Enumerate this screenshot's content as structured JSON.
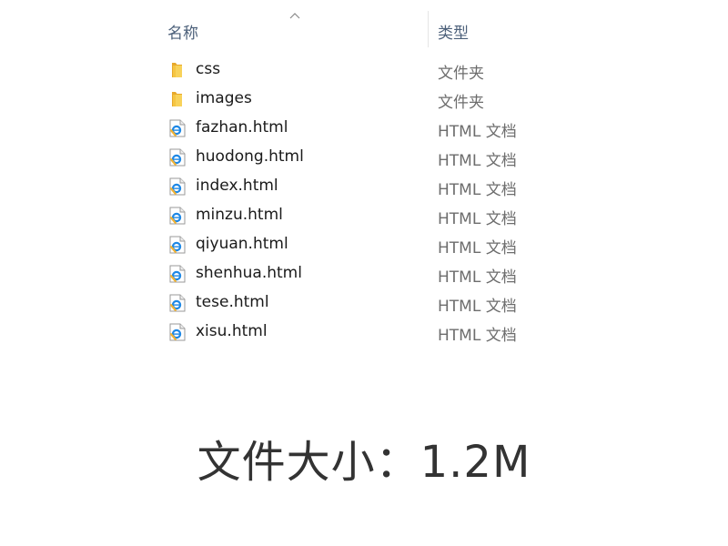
{
  "header": {
    "name_label": "名称",
    "type_label": "类型",
    "sort_icon": "sort-ascending-chevron"
  },
  "files": [
    {
      "name": "css",
      "type": "文件夹",
      "icon": "folder-icon"
    },
    {
      "name": "images",
      "type": "文件夹",
      "icon": "folder-icon"
    },
    {
      "name": "fazhan.html",
      "type": "HTML 文档",
      "icon": "html-file-icon"
    },
    {
      "name": "huodong.html",
      "type": "HTML 文档",
      "icon": "html-file-icon"
    },
    {
      "name": "index.html",
      "type": "HTML 文档",
      "icon": "html-file-icon"
    },
    {
      "name": "minzu.html",
      "type": "HTML 文档",
      "icon": "html-file-icon"
    },
    {
      "name": "qiyuan.html",
      "type": "HTML 文档",
      "icon": "html-file-icon"
    },
    {
      "name": "shenhua.html",
      "type": "HTML 文档",
      "icon": "html-file-icon"
    },
    {
      "name": "tese.html",
      "type": "HTML 文档",
      "icon": "html-file-icon"
    },
    {
      "name": "xisu.html",
      "type": "HTML 文档",
      "icon": "html-file-icon"
    }
  ],
  "caption": {
    "text": "文件大小：1.2M"
  },
  "colors": {
    "folder": "#f5c542",
    "ie_blue": "#1e88e5"
  }
}
